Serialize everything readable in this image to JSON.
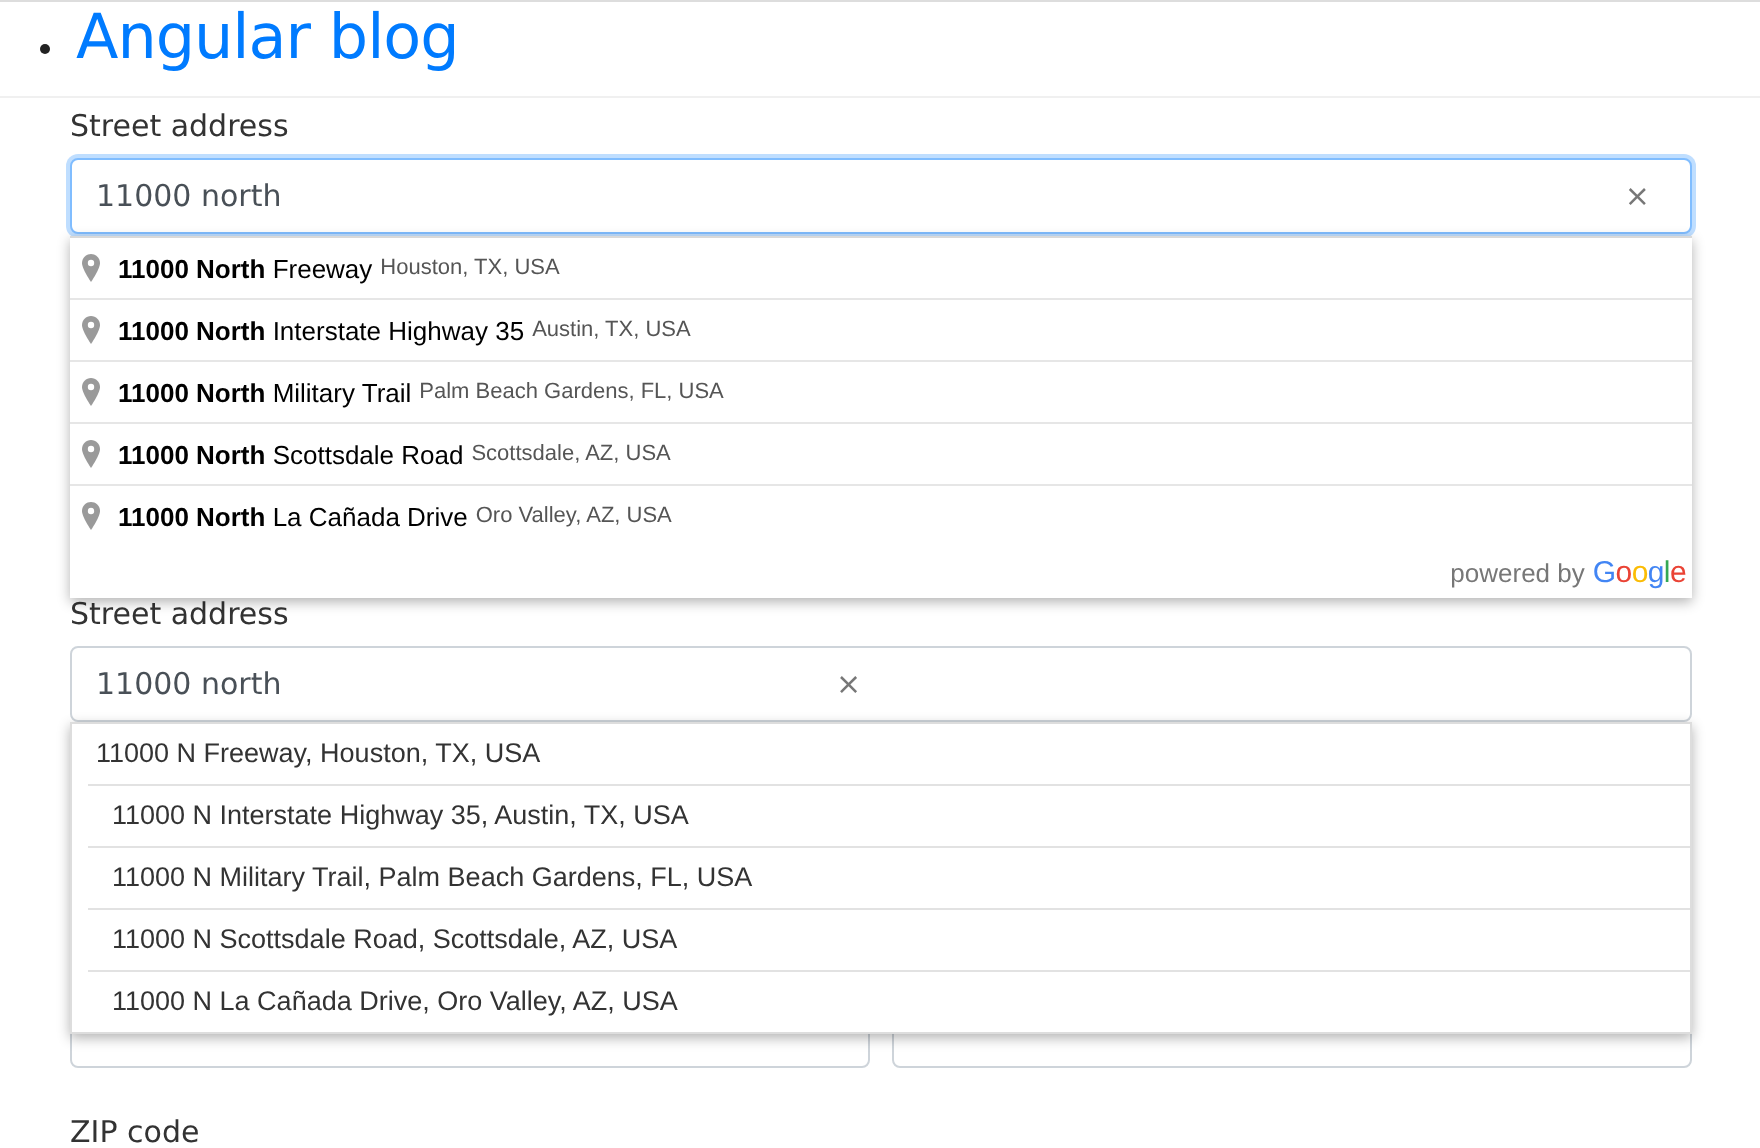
{
  "header": {
    "title": "Angular blog"
  },
  "autocomplete_google": {
    "label": "Street address",
    "value": "11000 north",
    "clear": "×",
    "suggestions": [
      {
        "main": "**11000 North** Freeway",
        "secondary": "Houston, TX, USA"
      },
      {
        "main": "**11000 North** Interstate Highway 35",
        "secondary": "Austin, TX, USA"
      },
      {
        "main": "**11000 North** Military Trail",
        "secondary": "Palm Beach Gardens, FL, USA"
      },
      {
        "main": "**11000 North** Scottsdale Road",
        "secondary": "Scottsdale, AZ, USA"
      },
      {
        "main": "**11000 North** La Cañada Drive",
        "secondary": "Oro Valley, AZ, USA"
      }
    ],
    "attribution": "powered by",
    "brand": "Google"
  },
  "autocomplete_plain": {
    "label": "Street address",
    "value": "11000 north",
    "clear": "×",
    "suggestions": [
      "11000 N Freeway, Houston, TX, USA",
      "11000 N Interstate Highway 35, Austin, TX, USA",
      "11000 N Military Trail, Palm Beach Gardens, FL, USA",
      "11000 N Scottsdale Road, Scottsdale, AZ, USA",
      "11000 N La Cañada Drive, Oro Valley, AZ, USA"
    ]
  },
  "zip_label": "ZIP code"
}
